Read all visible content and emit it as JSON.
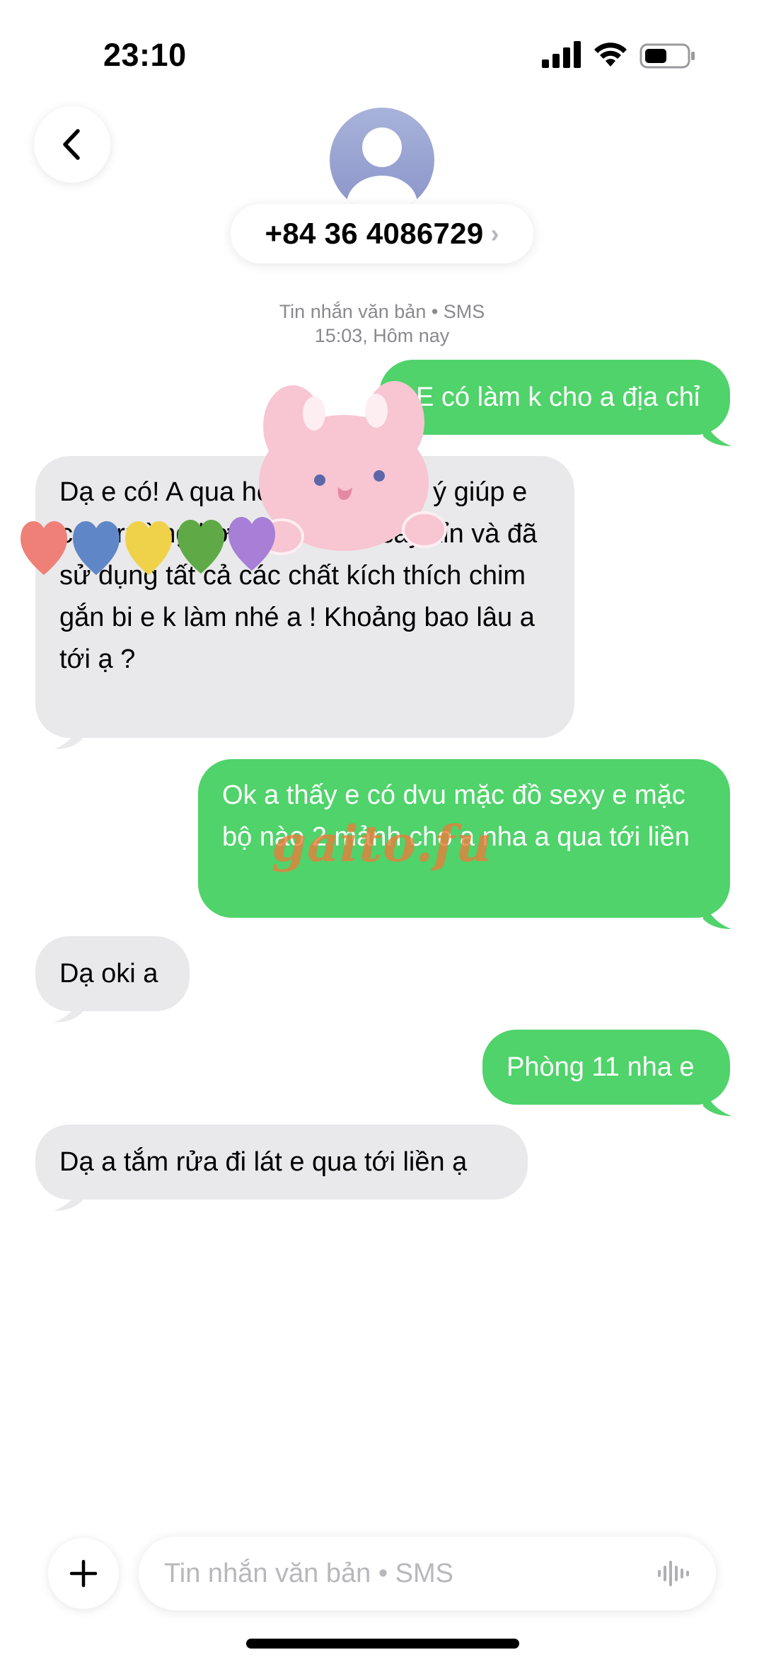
{
  "status_bar": {
    "time": "23:10",
    "icons": [
      "signal-icon",
      "wifi-icon",
      "battery-icon"
    ]
  },
  "header": {
    "back_icon": "chevron-left-icon",
    "avatar_icon": "person-icon",
    "contact_number": "+84 36 4086729",
    "contact_chevron": "›"
  },
  "meta": {
    "service_line": "Tin nhắn văn bản • SMS",
    "timestamp": "15:03, Hôm nay"
  },
  "messages": [
    {
      "direction": "outgoing",
      "text": "E có làm k cho a địa chỉ"
    },
    {
      "direction": "incoming",
      "text": "Dạ e có! A qua hẻm nha a ! Để ý giúp e các trường hợp nhậu nhẹt say xỉn và đã sử dụng tất cả các chất kích thích chim gắn bi e k làm nhé a ! Khoảng bao lâu a tới ạ ?"
    },
    {
      "direction": "outgoing",
      "text": "Ok a thấy e có dvu mặc đồ sexy e mặc bộ nào 2 mảnh cho a nha a qua tới liền"
    },
    {
      "direction": "incoming",
      "text": "Dạ oki a"
    },
    {
      "direction": "outgoing",
      "text": "Phòng 11 nha e"
    },
    {
      "direction": "incoming",
      "text": "Dạ a tắm rửa đi lát e qua tới liền ạ"
    }
  ],
  "overlays": {
    "watermark": "gaito.fu",
    "stickers": [
      "bunny-sticker",
      "rainbow-hearts-sticker"
    ]
  },
  "composer": {
    "placeholder": "Tin nhắn văn bản • SMS",
    "plus_icon": "plus-icon",
    "audio_icon": "waveform-icon"
  },
  "colors": {
    "outgoing_bubble": "#4fd36a",
    "incoming_bubble": "#e9e9eb",
    "meta_text": "#8a8a8e"
  }
}
